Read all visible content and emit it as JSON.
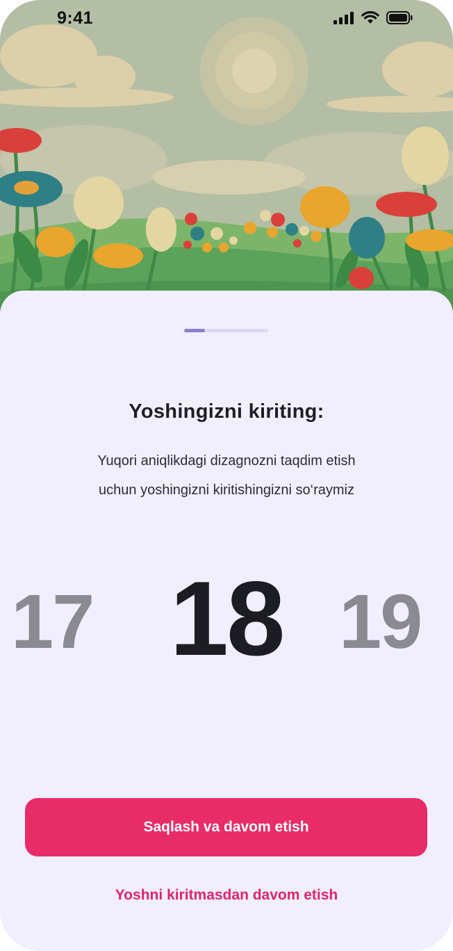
{
  "status_bar": {
    "time": "9:41",
    "icons": [
      "signal-icon",
      "wifi-icon",
      "battery-icon"
    ]
  },
  "hero": {
    "illustration": "flower-meadow-illustration"
  },
  "onboarding": {
    "progress": 0.25,
    "title": "Yoshingizni kiriting:",
    "subtitle_line1": "Yuqori aniqlikdagi dizagnozni taqdim etish",
    "subtitle_line2": "uchun yoshingizni kiritishingizni so‘raymiz"
  },
  "age_picker": {
    "previous": "17",
    "selected": "18",
    "next": "19"
  },
  "actions": {
    "save_label": "Saqlash va davom etish",
    "skip_label": "Yoshni kiritmasdan davom etish"
  },
  "colors": {
    "accent": "#e82c68",
    "sheet_background": "#f1effd",
    "progress_fill": "#8b7fd0"
  }
}
